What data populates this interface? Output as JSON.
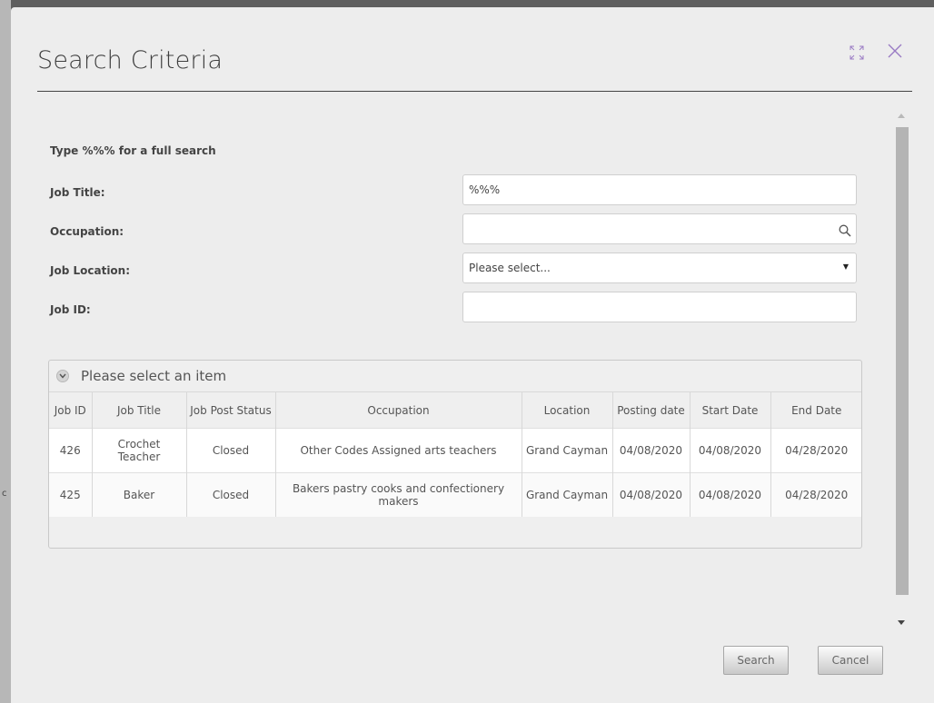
{
  "backdrop": {
    "partial_char": "c"
  },
  "dialog": {
    "title": "Search Criteria",
    "hint": "Type %%% for a full search",
    "fields": {
      "job_title": {
        "label": "Job Title:",
        "value": "%%%"
      },
      "occupation": {
        "label": "Occupation:",
        "value": "",
        "icon": "search-icon"
      },
      "job_location": {
        "label": "Job Location:",
        "selected": "Please select..."
      },
      "job_id": {
        "label": "Job ID:",
        "value": ""
      }
    },
    "results": {
      "group_label": "Please select an item",
      "columns": [
        "Job ID",
        "Job Title",
        "Job Post Status",
        "Occupation",
        "Location",
        "Posting date",
        "Start Date",
        "End Date"
      ],
      "rows": [
        [
          "426",
          "Crochet Teacher",
          "Closed",
          "Other Codes Assigned arts teachers",
          "Grand Cayman",
          "04/08/2020",
          "04/08/2020",
          "04/28/2020"
        ],
        [
          "425",
          "Baker",
          "Closed",
          "Bakers pastry cooks and confectionery makers",
          "Grand Cayman",
          "04/08/2020",
          "04/08/2020",
          "04/28/2020"
        ]
      ]
    },
    "buttons": {
      "search": "Search",
      "cancel": "Cancel"
    },
    "header_icons": [
      "expand-icon",
      "close-icon"
    ]
  },
  "colors": {
    "close_accent": "#9a7bc4",
    "rule": "#444444",
    "dialog_bg": "#ededed"
  }
}
